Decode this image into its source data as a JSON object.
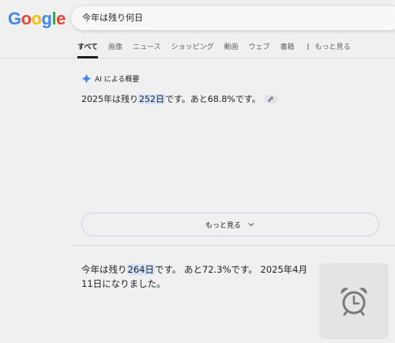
{
  "logo": {
    "letters": [
      "G",
      "o",
      "o",
      "g",
      "l",
      "e"
    ],
    "colors": [
      "#4285f4",
      "#ea4335",
      "#fbbc05",
      "#4285f4",
      "#34a853",
      "#ea4335"
    ]
  },
  "search": {
    "query": "今年は残り何日"
  },
  "tabs": [
    {
      "label": "すべて",
      "active": true
    },
    {
      "label": "画像"
    },
    {
      "label": "ニュース"
    },
    {
      "label": "ショッピング"
    },
    {
      "label": "動画"
    },
    {
      "label": "ウェブ"
    },
    {
      "label": "書籍"
    },
    {
      "label": "もっと見る",
      "icon": "more-vert-icon"
    }
  ],
  "ai_overview": {
    "title": "AI による概要",
    "icon": "gemini-sparkle-icon",
    "text_before": "2025年は残り",
    "highlight": "252日",
    "text_after": "です。あと68.8%です。",
    "link_icon": "link-icon",
    "accent": "#4285f4",
    "highlight_color": "#d3e3fd"
  },
  "more_button": {
    "label": "もっと見る",
    "icon": "chevron-down-icon"
  },
  "result": {
    "text_before": "今年は残り",
    "highlight": "264日",
    "text_after": "です。 あと72.3%です。 2025年4月11日になりました。",
    "thumbnail_icon": "alarm-clock-icon"
  }
}
